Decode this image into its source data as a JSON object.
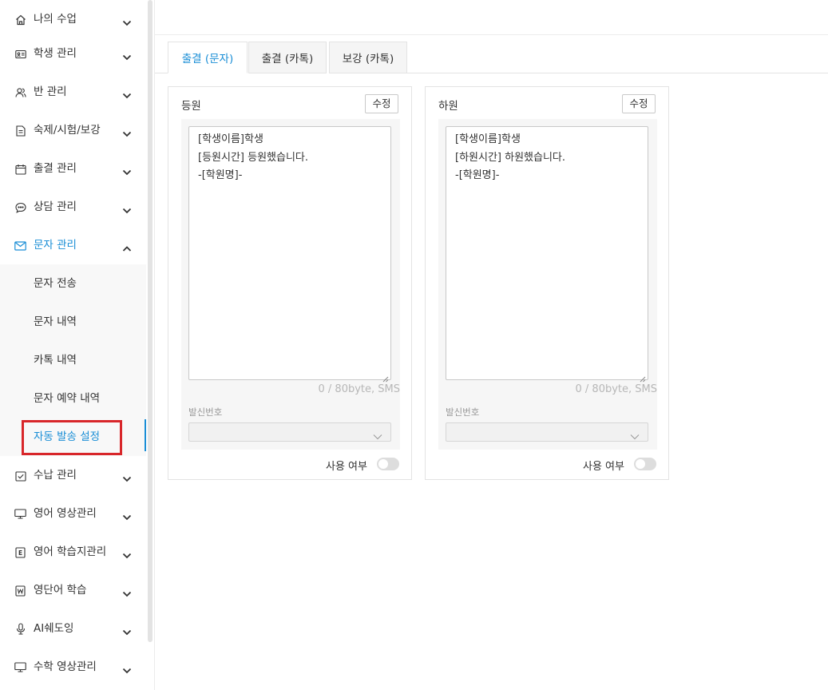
{
  "sidebar": {
    "items": [
      {
        "label": "나의 수업",
        "icon": "home-icon"
      },
      {
        "label": "학생 관리",
        "icon": "id-card-icon"
      },
      {
        "label": "반 관리",
        "icon": "users-icon"
      },
      {
        "label": "숙제/시험/보강",
        "icon": "document-icon"
      },
      {
        "label": "출결 관리",
        "icon": "calendar-icon"
      },
      {
        "label": "상담 관리",
        "icon": "chat-icon"
      },
      {
        "label": "문자 관리",
        "icon": "mail-icon"
      },
      {
        "label": "수납 관리",
        "icon": "receipt-icon"
      },
      {
        "label": "영어 영상관리",
        "icon": "monitor-icon"
      },
      {
        "label": "영어 학습지관리",
        "icon": "e-book-icon"
      },
      {
        "label": "영단어 학습",
        "icon": "w-book-icon"
      },
      {
        "label": "AI쉐도잉",
        "icon": "microphone-icon"
      },
      {
        "label": "수학 영상관리",
        "icon": "monitor-icon"
      }
    ],
    "sub_items": [
      {
        "label": "문자 전송"
      },
      {
        "label": "문자 내역"
      },
      {
        "label": "카톡 내역"
      },
      {
        "label": "문자 예약 내역"
      },
      {
        "label": "자동 발송 설정"
      }
    ],
    "active_item": "문자 관리",
    "selected_sub_item": "자동 발송 설정"
  },
  "tabs": [
    {
      "label": "출결 (문자)",
      "active": true
    },
    {
      "label": "출결 (카톡)",
      "active": false
    },
    {
      "label": "보강 (카톡)",
      "active": false
    }
  ],
  "cards": [
    {
      "title": "등원",
      "edit_label": "수정",
      "message_lines": [
        "[학생이름]학생",
        "[등원시간] 등원했습니다.",
        "-[학원명]-"
      ],
      "counter": "0 / 80byte, SMS",
      "sender_label": "발신번호",
      "sender_value": "",
      "use_label": "사용 여부",
      "use_enabled": false
    },
    {
      "title": "하원",
      "edit_label": "수정",
      "message_lines": [
        "[학생이름]학생",
        "[하원시간] 하원했습니다.",
        "-[학원명]-"
      ],
      "counter": "0 / 80byte, SMS",
      "sender_label": "발신번호",
      "sender_value": "",
      "use_label": "사용 여부",
      "use_enabled": false
    }
  ],
  "colors": {
    "accent": "#1a8ed6",
    "highlight_box": "#d8262a",
    "border": "#e3e3e3"
  }
}
